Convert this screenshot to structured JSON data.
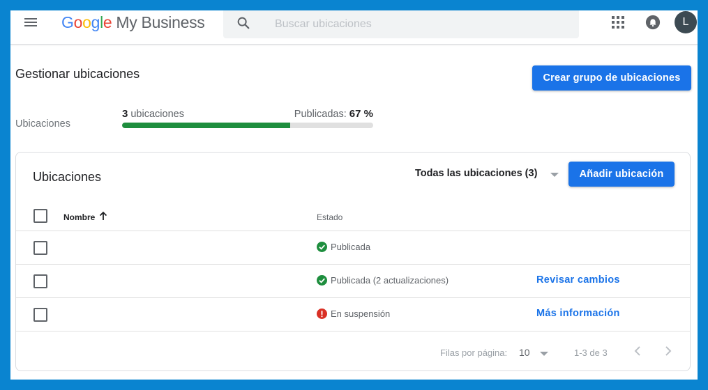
{
  "header": {
    "logo_google": [
      "G",
      "o",
      "o",
      "g",
      "l",
      "e"
    ],
    "product": "My Business",
    "search_placeholder": "Buscar ubicaciones",
    "avatar_letter": "L"
  },
  "page": {
    "title": "Gestionar ubicaciones",
    "create_group_button": "Crear grupo de ubicaciones",
    "summary_label": "Ubicaciones",
    "count_number": "3",
    "count_text": " ubicaciones",
    "published_label": "Publicadas: ",
    "published_percent": "67 %",
    "published_fraction": 0.67
  },
  "card": {
    "title": "Ubicaciones",
    "filter_label": "Todas las ubicaciones (3)",
    "add_button": "Añadir ubicación",
    "columns": {
      "name": "Nombre",
      "status": "Estado"
    },
    "rows": [
      {
        "status": "Publicada",
        "status_icon": "check-circle-icon",
        "action": ""
      },
      {
        "status": "Publicada (2 actualizaciones)",
        "status_icon": "check-circle-icon",
        "action": "Revisar cambios"
      },
      {
        "status": "En suspensión",
        "status_icon": "error-circle-icon",
        "action": "Más información"
      }
    ],
    "footer": {
      "rows_per_page_label": "Filas por página:",
      "rows_per_page_value": "10",
      "range": "1-3 de 3"
    }
  },
  "colors": {
    "accent": "#1a73e8",
    "success": "#1e8e3e",
    "error": "#d93025",
    "frame_border": "#0a84d0"
  }
}
